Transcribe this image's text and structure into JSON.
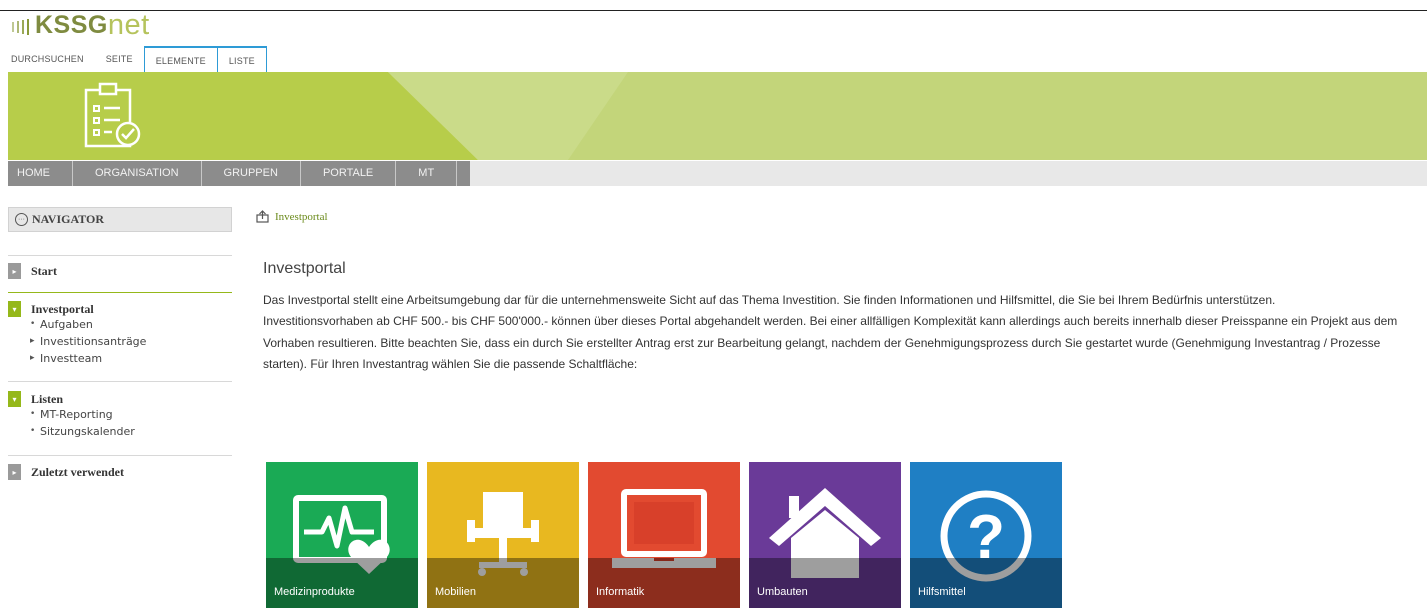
{
  "logo": {
    "part1": "KSSG",
    "part2": "net"
  },
  "ribbon_tabs": [
    "DURCHSUCHEN",
    "SEITE",
    "ELEMENTE",
    "LISTE"
  ],
  "main_nav": [
    "HOME",
    "ORGANISATION",
    "GRUPPEN",
    "PORTALE",
    "MT"
  ],
  "navigator": {
    "label": "NAVIGATOR"
  },
  "sidebar": {
    "start": {
      "label": "Start"
    },
    "investportal": {
      "label": "Investportal",
      "items": [
        "Aufgaben",
        "Investitionsanträge",
        "Investteam"
      ]
    },
    "listen": {
      "label": "Listen",
      "items": [
        "MT-Reporting",
        "Sitzungskalender"
      ]
    },
    "zuletzt": {
      "label": "Zuletzt verwendet"
    }
  },
  "breadcrumb": "Investportal",
  "main": {
    "title": "Investportal",
    "paragraph1": "Das Investportal stellt eine Arbeitsumgebung dar für die unternehmensweite Sicht auf das Thema Investition. Sie finden Informationen und Hilfsmittel, die Sie bei Ihrem Bedürfnis unterstützen.",
    "paragraph2": "Investitionsvorhaben ab CHF 500.- bis CHF 500'000.- können über dieses Portal abgehandelt werden. Bei einer allfälligen Komplexität kann allerdings auch bereits innerhalb dieser Preisspanne ein Projekt aus dem Vorhaben resultieren. Bitte beachten Sie, dass ein durch Sie erstellter Antrag erst zur Bearbeitung gelangt, nachdem der Genehmigungsprozess durch Sie gestartet wurde (Genehmigung Investantrag / Prozesse starten). Für Ihren Investantrag wählen Sie die passende Schaltfläche:"
  },
  "tiles": [
    {
      "label": "Medizinprodukte",
      "color": "#1aaa55",
      "icon": "heart-monitor-icon"
    },
    {
      "label": "Mobilien",
      "color": "#e8b820",
      "icon": "chair-icon"
    },
    {
      "label": "Informatik",
      "color": "#e24a30",
      "icon": "laptop-icon"
    },
    {
      "label": "Umbauten",
      "color": "#6a3a98",
      "icon": "house-icon"
    },
    {
      "label": "Hilfsmittel",
      "color": "#1f7fc4",
      "icon": "question-icon"
    }
  ],
  "colors": {
    "accent_green": "#95b81a",
    "banner_green": "#b7cd4a",
    "nav_gray": "#8c8c8c",
    "link_blue": "#2e9bd6"
  }
}
